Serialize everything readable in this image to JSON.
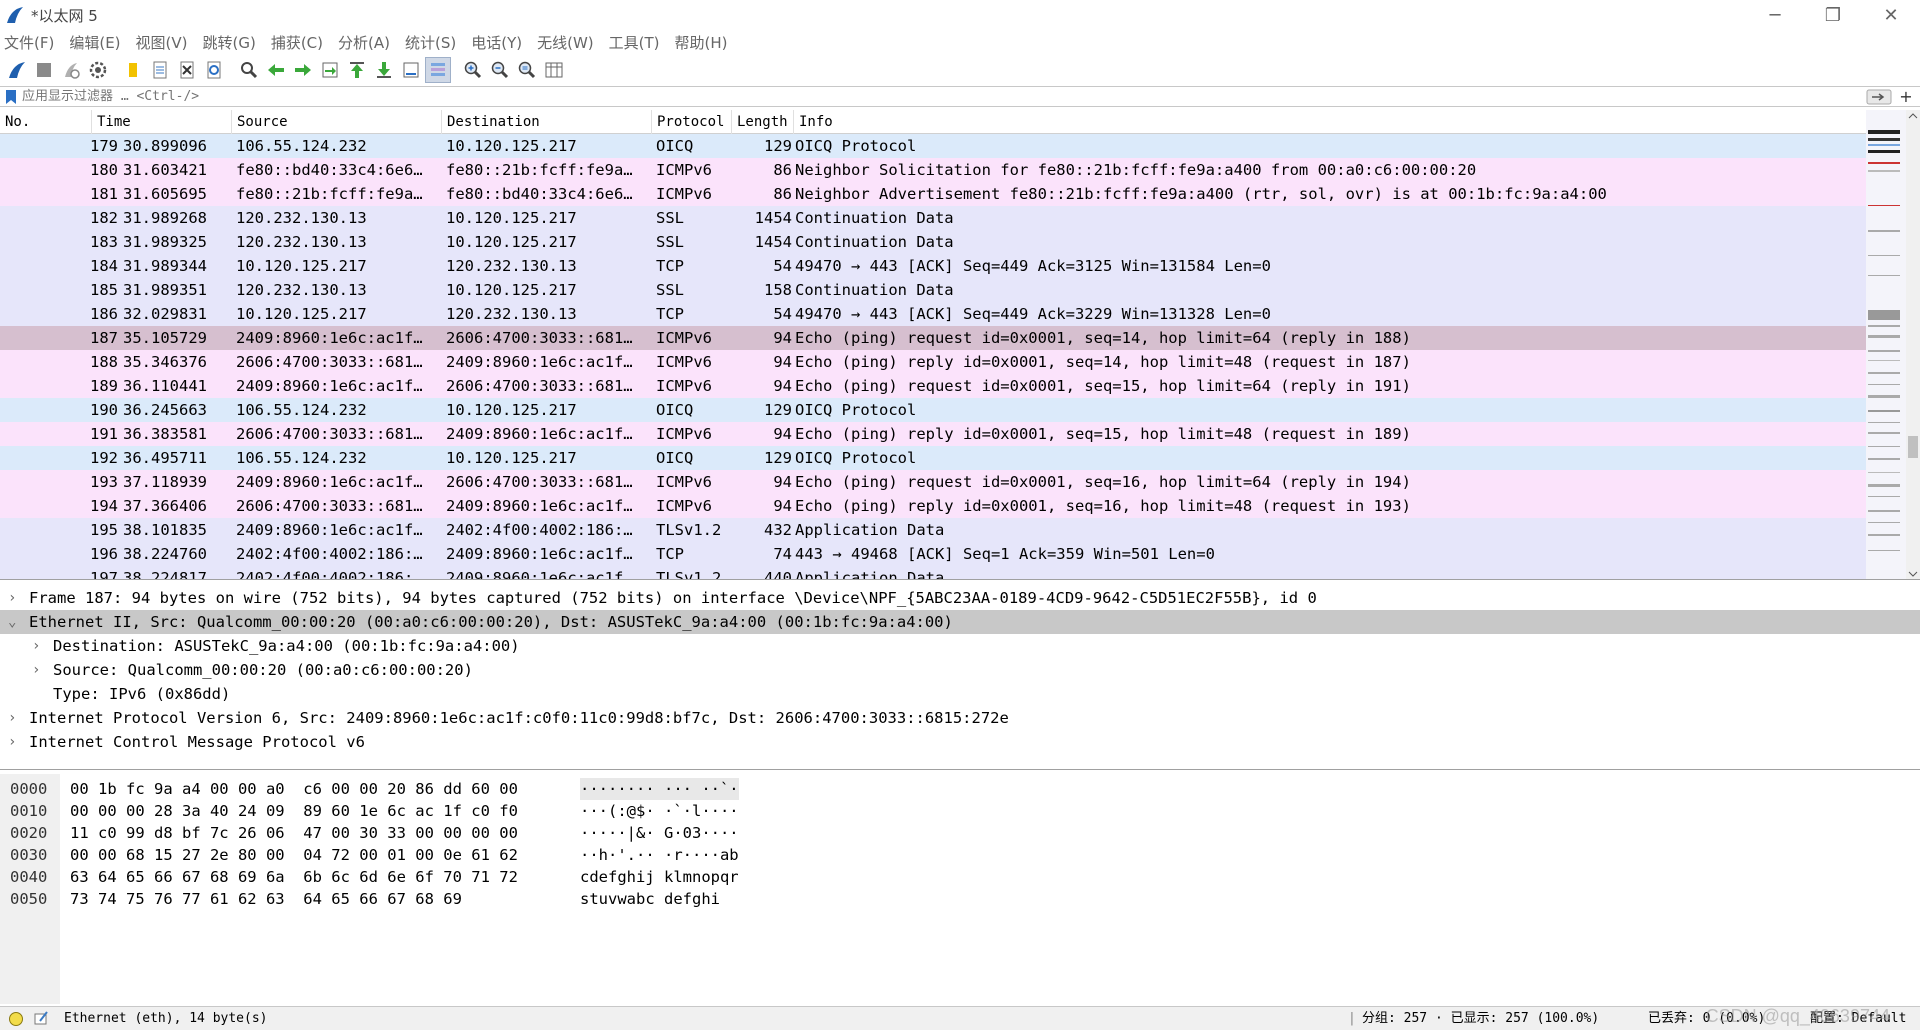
{
  "window": {
    "title": "*以太网 5",
    "minimize": "─",
    "restore": "❐",
    "close": "✕"
  },
  "menu": [
    "文件(F)",
    "编辑(E)",
    "视图(V)",
    "跳转(G)",
    "捕获(C)",
    "分析(A)",
    "统计(S)",
    "电话(Y)",
    "无线(W)",
    "工具(T)",
    "帮助(H)"
  ],
  "filter": {
    "placeholder": "应用显示过滤器 … <Ctrl-/>",
    "plus": "+"
  },
  "columns": {
    "no": "No.",
    "time": "Time",
    "source": "Source",
    "destination": "Destination",
    "protocol": "Protocol",
    "length": "Length",
    "info": "Info"
  },
  "colors": {
    "oicq": "#dbeafa",
    "icmpv6": "#fbe3fb",
    "tcp": "#e6e6fa",
    "selected": "#d6bfcf",
    "detail_selected": "#c8c8c8"
  },
  "packets": [
    {
      "no": "179",
      "time": "30.899096",
      "source": "106.55.124.232",
      "destination": "10.120.125.217",
      "protocol": "OICQ",
      "length": "129",
      "info": "OICQ Protocol",
      "color": "#dbeafa"
    },
    {
      "no": "180",
      "time": "31.603421",
      "source": "fe80::bd40:33c4:6e6…",
      "destination": "fe80::21b:fcff:fe9a…",
      "protocol": "ICMPv6",
      "length": "86",
      "info": "Neighbor Solicitation for fe80::21b:fcff:fe9a:a400 from 00:a0:c6:00:00:20",
      "color": "#fbe3fb"
    },
    {
      "no": "181",
      "time": "31.605695",
      "source": "fe80::21b:fcff:fe9a…",
      "destination": "fe80::bd40:33c4:6e6…",
      "protocol": "ICMPv6",
      "length": "86",
      "info": "Neighbor Advertisement fe80::21b:fcff:fe9a:a400 (rtr, sol, ovr) is at 00:1b:fc:9a:a4:00",
      "color": "#fbe3fb"
    },
    {
      "no": "182",
      "time": "31.989268",
      "source": "120.232.130.13",
      "destination": "10.120.125.217",
      "protocol": "SSL",
      "length": "1454",
      "info": "Continuation Data",
      "color": "#e6e6fa"
    },
    {
      "no": "183",
      "time": "31.989325",
      "source": "120.232.130.13",
      "destination": "10.120.125.217",
      "protocol": "SSL",
      "length": "1454",
      "info": "Continuation Data",
      "color": "#e6e6fa"
    },
    {
      "no": "184",
      "time": "31.989344",
      "source": "10.120.125.217",
      "destination": "120.232.130.13",
      "protocol": "TCP",
      "length": "54",
      "info": "49470 → 443 [ACK] Seq=449 Ack=3125 Win=131584 Len=0",
      "color": "#e6e6fa"
    },
    {
      "no": "185",
      "time": "31.989351",
      "source": "120.232.130.13",
      "destination": "10.120.125.217",
      "protocol": "SSL",
      "length": "158",
      "info": "Continuation Data",
      "color": "#e6e6fa"
    },
    {
      "no": "186",
      "time": "32.029831",
      "source": "10.120.125.217",
      "destination": "120.232.130.13",
      "protocol": "TCP",
      "length": "54",
      "info": "49470 → 443 [ACK] Seq=449 Ack=3229 Win=131328 Len=0",
      "color": "#e6e6fa"
    },
    {
      "no": "187",
      "time": "35.105729",
      "source": "2409:8960:1e6c:ac1f…",
      "destination": "2606:4700:3033::681…",
      "protocol": "ICMPv6",
      "length": "94",
      "info": "Echo (ping) request id=0x0001, seq=14, hop limit=64 (reply in 188)",
      "color": "#d6bfcf"
    },
    {
      "no": "188",
      "time": "35.346376",
      "source": "2606:4700:3033::681…",
      "destination": "2409:8960:1e6c:ac1f…",
      "protocol": "ICMPv6",
      "length": "94",
      "info": "Echo (ping) reply id=0x0001, seq=14, hop limit=48 (request in 187)",
      "color": "#fbe3fb"
    },
    {
      "no": "189",
      "time": "36.110441",
      "source": "2409:8960:1e6c:ac1f…",
      "destination": "2606:4700:3033::681…",
      "protocol": "ICMPv6",
      "length": "94",
      "info": "Echo (ping) request id=0x0001, seq=15, hop limit=64 (reply in 191)",
      "color": "#fbe3fb"
    },
    {
      "no": "190",
      "time": "36.245663",
      "source": "106.55.124.232",
      "destination": "10.120.125.217",
      "protocol": "OICQ",
      "length": "129",
      "info": "OICQ Protocol",
      "color": "#dbeafa"
    },
    {
      "no": "191",
      "time": "36.383581",
      "source": "2606:4700:3033::681…",
      "destination": "2409:8960:1e6c:ac1f…",
      "protocol": "ICMPv6",
      "length": "94",
      "info": "Echo (ping) reply id=0x0001, seq=15, hop limit=48 (request in 189)",
      "color": "#fbe3fb"
    },
    {
      "no": "192",
      "time": "36.495711",
      "source": "106.55.124.232",
      "destination": "10.120.125.217",
      "protocol": "OICQ",
      "length": "129",
      "info": "OICQ Protocol",
      "color": "#dbeafa"
    },
    {
      "no": "193",
      "time": "37.118939",
      "source": "2409:8960:1e6c:ac1f…",
      "destination": "2606:4700:3033::681…",
      "protocol": "ICMPv6",
      "length": "94",
      "info": "Echo (ping) request id=0x0001, seq=16, hop limit=64 (reply in 194)",
      "color": "#fbe3fb"
    },
    {
      "no": "194",
      "time": "37.366406",
      "source": "2606:4700:3033::681…",
      "destination": "2409:8960:1e6c:ac1f…",
      "protocol": "ICMPv6",
      "length": "94",
      "info": "Echo (ping) reply id=0x0001, seq=16, hop limit=48 (request in 193)",
      "color": "#fbe3fb"
    },
    {
      "no": "195",
      "time": "38.101835",
      "source": "2409:8960:1e6c:ac1f…",
      "destination": "2402:4f00:4002:186:…",
      "protocol": "TLSv1.2",
      "length": "432",
      "info": "Application Data",
      "color": "#e6e6fa"
    },
    {
      "no": "196",
      "time": "38.224760",
      "source": "2402:4f00:4002:186:…",
      "destination": "2409:8960:1e6c:ac1f…",
      "protocol": "TCP",
      "length": "74",
      "info": "443 → 49468 [ACK] Seq=1 Ack=359 Win=501 Len=0",
      "color": "#e6e6fa"
    },
    {
      "no": "197",
      "time": "38.224817",
      "source": "2402:4f00:4002:186:…",
      "destination": "2409:8960:1e6c:ac1f…",
      "protocol": "TLSv1.2",
      "length": "440",
      "info": "Application Data",
      "color": "#e6e6fa"
    }
  ],
  "details": [
    {
      "arrow": "›",
      "indent": 0,
      "text": "Frame 187: 94 bytes on wire (752 bits), 94 bytes captured (752 bits) on interface \\Device\\NPF_{5ABC23AA-0189-4CD9-9642-C5D51EC2F55B}, id 0"
    },
    {
      "arrow": "⌄",
      "indent": 0,
      "text": "Ethernet II, Src: Qualcomm_00:00:20 (00:a0:c6:00:00:20), Dst: ASUSTekC_9a:a4:00 (00:1b:fc:9a:a4:00)",
      "selected": true
    },
    {
      "arrow": "›",
      "indent": 1,
      "text": "Destination: ASUSTekC_9a:a4:00 (00:1b:fc:9a:a4:00)"
    },
    {
      "arrow": "›",
      "indent": 1,
      "text": "Source: Qualcomm_00:00:20 (00:a0:c6:00:00:20)"
    },
    {
      "arrow": "",
      "indent": 1,
      "text": "Type: IPv6 (0x86dd)"
    },
    {
      "arrow": "›",
      "indent": 0,
      "text": "Internet Protocol Version 6, Src: 2409:8960:1e6c:ac1f:c0f0:11c0:99d8:bf7c, Dst: 2606:4700:3033::6815:272e"
    },
    {
      "arrow": "›",
      "indent": 0,
      "text": "Internet Control Message Protocol v6"
    }
  ],
  "bytes": [
    {
      "offset": "0000",
      "hex": "00 1b fc 9a a4 00 00 a0  c6 00 00 20 86 dd 60 00",
      "ascii": "········ ··· ··`·"
    },
    {
      "offset": "0010",
      "hex": "00 00 00 28 3a 40 24 09  89 60 1e 6c ac 1f c0 f0",
      "ascii": "···(:@$· ·`·l····"
    },
    {
      "offset": "0020",
      "hex": "11 c0 99 d8 bf 7c 26 06  47 00 30 33 00 00 00 00",
      "ascii": "·····|&· G·03····"
    },
    {
      "offset": "0030",
      "hex": "00 00 68 15 27 2e 80 00  04 72 00 01 00 0e 61 62",
      "ascii": "··h·'.·· ·r····ab"
    },
    {
      "offset": "0040",
      "hex": "63 64 65 66 67 68 69 6a  6b 6c 6d 6e 6f 70 71 72",
      "ascii": "cdefghij klmnopqr"
    },
    {
      "offset": "0050",
      "hex": "73 74 75 76 77 61 62 63  64 65 66 67 68 69",
      "ascii": "stuvwabc defghi"
    }
  ],
  "status": {
    "field": "Ethernet (eth), 14 byte(s)",
    "packets": "分组: 257 · 已显示: 257 (100.0%)",
    "dropped": "已丢弃: 0 (0.0%)",
    "profile": "配置: Default"
  },
  "watermark": "CSDN @qq_40639744",
  "icons": [
    "shark-fin-start-icon",
    "stop-icon",
    "restart-icon",
    "options-gear-icon",
    "open-folder-icon",
    "save-file-icon",
    "close-file-icon",
    "reload-icon",
    "find-icon",
    "back-arrow-icon",
    "forward-arrow-icon",
    "goto-packet-icon",
    "first-packet-icon",
    "last-packet-icon",
    "autoscroll-icon",
    "colorize-icon",
    "zoom-in-icon",
    "zoom-out-icon",
    "normal-size-icon",
    "resize-columns-icon"
  ]
}
